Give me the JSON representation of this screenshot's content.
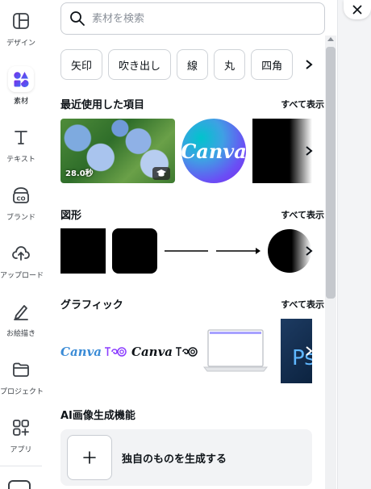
{
  "rail": {
    "items": [
      {
        "label": "デザイン",
        "icon": "layout-icon"
      },
      {
        "label": "素材",
        "icon": "elements-icon"
      },
      {
        "label": "テキスト",
        "icon": "text-icon"
      },
      {
        "label": "ブランド",
        "icon": "brand-icon"
      },
      {
        "label": "アップロード",
        "icon": "upload-icon"
      },
      {
        "label": "お絵描き",
        "icon": "draw-icon"
      },
      {
        "label": "プロジェクト",
        "icon": "folder-icon"
      },
      {
        "label": "アプリ",
        "icon": "apps-icon"
      }
    ],
    "active_index": 1
  },
  "search": {
    "placeholder": "素材を検索"
  },
  "chips": [
    "矢印",
    "吹き出し",
    "線",
    "丸",
    "四角"
  ],
  "recent": {
    "title": "最近使用した項目",
    "see_all": "すべて表示",
    "photo_badge": "28.0秒",
    "canva_logo_text": "Canva"
  },
  "shapes": {
    "title": "図形",
    "see_all": "すべて表示"
  },
  "graphics": {
    "title": "グラフィック",
    "see_all": "すべて表示",
    "item1_text": "Canva",
    "item2_text": "Canva",
    "partial_text": "Ps"
  },
  "ai": {
    "title": "AI画像生成機能",
    "button_label": "独自のものを生成する"
  },
  "colors": {
    "accent": "#8b3dff",
    "canva_teal": "#00c4cc",
    "canva_purple": "#7d2ae8"
  }
}
